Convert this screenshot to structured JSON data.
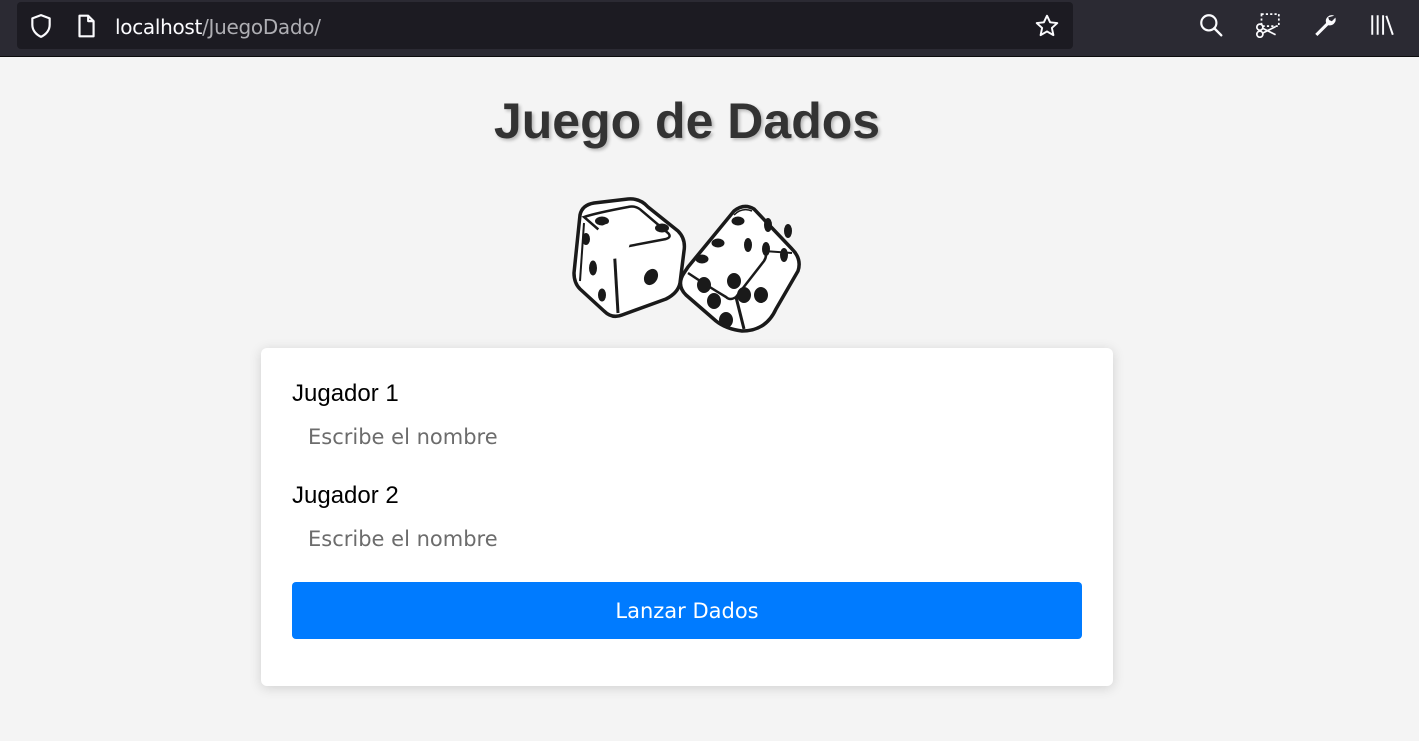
{
  "browser": {
    "url_host": "localhost",
    "url_path": "/JuegoDado/"
  },
  "page": {
    "title": "Juego de Dados"
  },
  "form": {
    "player1_label": "Jugador 1",
    "player1_placeholder": "Escribe el nombre",
    "player1_value": "",
    "player2_label": "Jugador 2",
    "player2_placeholder": "Escribe el nombre",
    "player2_value": "",
    "submit_label": "Lanzar Dados"
  },
  "colors": {
    "button": "#007bff",
    "toolbar": "#2b2a33",
    "page_bg": "#f4f4f4"
  },
  "icons": [
    "shield-icon",
    "page-icon",
    "bookmark-star-icon",
    "search-icon",
    "screenshot-icon",
    "wrench-icon",
    "library-icon",
    "dice-image"
  ]
}
